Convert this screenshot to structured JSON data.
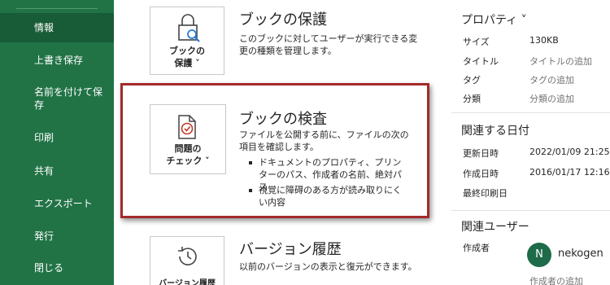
{
  "sidebar": {
    "items": [
      {
        "label": "情報",
        "active": true
      },
      {
        "label": "上書き保存"
      },
      {
        "label": "名前を付けて保存"
      },
      {
        "label": "印刷"
      },
      {
        "label": "共有"
      },
      {
        "label": "エクスポート"
      },
      {
        "label": "発行"
      },
      {
        "label": "閉じる"
      }
    ]
  },
  "cards": {
    "protect": {
      "button_line1": "ブックの",
      "button_line2": "保護 ˅",
      "title": "ブックの保護",
      "desc": "このブックに対してユーザーが実行できる変更の種類を管理します。"
    },
    "inspect": {
      "button_line1": "問題の",
      "button_line2": "チェック ˅",
      "title": "ブックの検査",
      "desc": "ファイルを公開する前に、ファイルの次の項目を確認します。",
      "bullets": [
        "ドキュメントのプロパティ、プリンターのパス、作成者の名前、絶対パス",
        "視覚に障碍のある方が読み取りにくい内容"
      ]
    },
    "version": {
      "button_line1": "バージョン履歴",
      "title": "バージョン履歴",
      "desc": "以前のバージョンの表示と復元ができます。"
    }
  },
  "properties": {
    "title": "プロパティ ˅",
    "rows": [
      {
        "label": "サイズ",
        "value": "130KB",
        "placeholder": false
      },
      {
        "label": "タイトル",
        "value": "タイトルの追加",
        "placeholder": true
      },
      {
        "label": "タグ",
        "value": "タグの追加",
        "placeholder": true
      },
      {
        "label": "分類",
        "value": "分類の追加",
        "placeholder": true
      }
    ]
  },
  "dates": {
    "title": "関連する日付",
    "rows": [
      {
        "label": "更新日時",
        "value": "2022/01/09 21:25"
      },
      {
        "label": "作成日時",
        "value": "2016/01/17 12:16"
      },
      {
        "label": "最終印刷日",
        "value": ""
      }
    ]
  },
  "people": {
    "title": "関連ユーザー",
    "author_label": "作成者",
    "avatar_initial": "N",
    "author_name": "nekogen",
    "add_author": "作成者の追加"
  },
  "colors": {
    "sidebar": "#217346",
    "sidebar_active": "#185c37",
    "highlight": "#a32a2a"
  }
}
